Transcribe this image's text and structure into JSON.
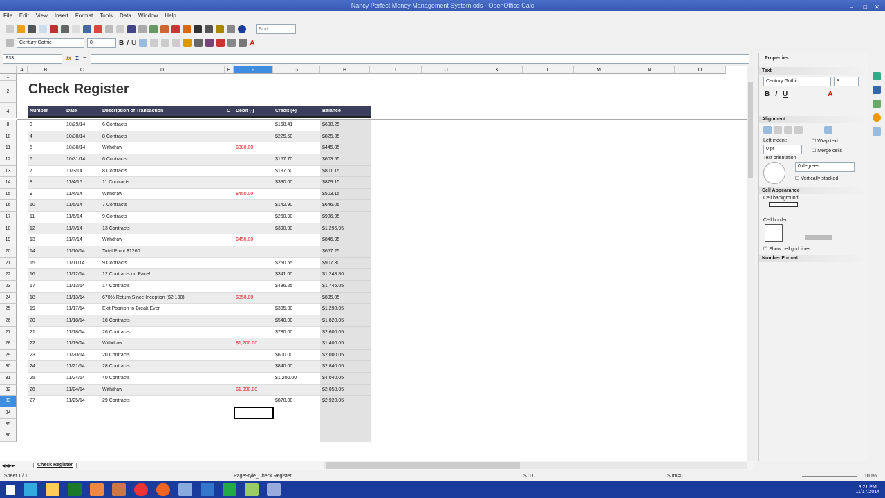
{
  "window": {
    "title": "Nancy Perfect Money Management System.ods - OpenOffice Calc"
  },
  "menu": [
    "File",
    "Edit",
    "View",
    "Insert",
    "Format",
    "Tools",
    "Data",
    "Window",
    "Help"
  ],
  "toolbar": {
    "find_placeholder": "Find",
    "font_name": "Century Gothic",
    "font_size": "8"
  },
  "formula_bar": {
    "cell_ref": "F33",
    "value": ""
  },
  "columns": [
    "A",
    "B",
    "C",
    "D",
    "E",
    "F",
    "G",
    "H",
    "I",
    "J",
    "K",
    "L",
    "M",
    "N",
    "O"
  ],
  "sheet": {
    "title": "Check Register",
    "headers": [
      "Number",
      "Date",
      "Description of Transaction",
      "C",
      "Debit (-)",
      "Credit (+)",
      "Balance"
    ],
    "rows": [
      {
        "row": "8",
        "num": "3",
        "date": "10/29/14",
        "desc": "6 Contracts",
        "debit": "",
        "credit": "$168.41",
        "balance": "$600.25"
      },
      {
        "row": "10",
        "num": "4",
        "date": "10/30/14",
        "desc": "8 Contracts",
        "debit": "",
        "credit": "$225.60",
        "balance": "$825.85"
      },
      {
        "row": "11",
        "num": "5",
        "date": "10/30/14",
        "desc": "Withdraw",
        "debit": "$380.00",
        "credit": "",
        "balance": "$445.85"
      },
      {
        "row": "12",
        "num": "6",
        "date": "10/31/14",
        "desc": "6 Contracts",
        "debit": "",
        "credit": "$157.70",
        "balance": "$603.55"
      },
      {
        "row": "13",
        "num": "7",
        "date": "11/3/14",
        "desc": "8 Contracts",
        "debit": "",
        "credit": "$197.60",
        "balance": "$801.15"
      },
      {
        "row": "14",
        "num": "8",
        "date": "11/4/15",
        "desc": "11 Contracts",
        "debit": "",
        "credit": "$330.00",
        "balance": "$879.15"
      },
      {
        "row": "15",
        "num": "9",
        "date": "11/4/14",
        "desc": "Withdraw",
        "debit": "$450.00",
        "credit": "",
        "balance": "$503.15"
      },
      {
        "row": "16",
        "num": "10",
        "date": "11/5/14",
        "desc": "7 Contracts",
        "debit": "",
        "credit": "$142.90",
        "balance": "$646.05"
      },
      {
        "row": "17",
        "num": "11",
        "date": "11/6/14",
        "desc": "9 Contracts",
        "debit": "",
        "credit": "$260.90",
        "balance": "$906.95"
      },
      {
        "row": "18",
        "num": "12",
        "date": "11/7/14",
        "desc": "13 Contracts",
        "debit": "",
        "credit": "$390.00",
        "balance": "$1,296.95"
      },
      {
        "row": "19",
        "num": "13",
        "date": "11/7/14",
        "desc": "Withdraw",
        "debit": "$450.00",
        "credit": "",
        "balance": "$846.95"
      },
      {
        "row": "20",
        "num": "14",
        "date": "11/10/14",
        "desc": "Total Profit  $1260",
        "debit": "",
        "credit": "",
        "balance": "$657.25"
      },
      {
        "row": "21",
        "num": "15",
        "date": "11/11/14",
        "desc": "9 Contracts",
        "debit": "",
        "credit": "$250.55",
        "balance": "$907.80"
      },
      {
        "row": "22",
        "num": "16",
        "date": "11/12/14",
        "desc": "12 Contracts on Pace!",
        "debit": "",
        "credit": "$341.00",
        "balance": "$1,248.80"
      },
      {
        "row": "23",
        "num": "17",
        "date": "11/13/14",
        "desc": "17 Contracts",
        "debit": "",
        "credit": "$496.25",
        "balance": "$1,745.05"
      },
      {
        "row": "24",
        "num": "18",
        "date": "11/13/14",
        "desc": "670% Return Since Inception ($2,130)",
        "debit": "$850.00",
        "credit": "",
        "balance": "$895.05"
      },
      {
        "row": "25",
        "num": "19",
        "date": "11/17/14",
        "desc": "Exit Position to Break Even",
        "debit": "",
        "credit": "$395.00",
        "balance": "$1,290.05"
      },
      {
        "row": "26",
        "num": "20",
        "date": "11/18/14",
        "desc": "18 Contracts",
        "debit": "",
        "credit": "$540.00",
        "balance": "$1,820.05"
      },
      {
        "row": "27",
        "num": "21",
        "date": "11/18/14",
        "desc": "26 Contracts",
        "debit": "",
        "credit": "$780.00",
        "balance": "$2,600.05"
      },
      {
        "row": "28",
        "num": "22",
        "date": "11/19/14",
        "desc": "Withdraw",
        "debit": "$1,200.00",
        "credit": "",
        "balance": "$1,400.05"
      },
      {
        "row": "29",
        "num": "23",
        "date": "11/20/14",
        "desc": "20 Contracts",
        "debit": "",
        "credit": "$600.00",
        "balance": "$2,000.05"
      },
      {
        "row": "30",
        "num": "24",
        "date": "11/21/14",
        "desc": "28 Contracts",
        "debit": "",
        "credit": "$840.00",
        "balance": "$2,840.05"
      },
      {
        "row": "31",
        "num": "25",
        "date": "11/24/14",
        "desc": "40 Contracts",
        "debit": "",
        "credit": "$1,200.00",
        "balance": "$4,040.05"
      },
      {
        "row": "32",
        "num": "26",
        "date": "11/24/14",
        "desc": "Withdraw",
        "debit": "$1,990.00",
        "credit": "",
        "balance": "$2,050.05"
      },
      {
        "row": "33",
        "num": "27",
        "date": "11/25/14",
        "desc": "29 Contracts",
        "debit": "",
        "credit": "$870.00",
        "balance": "$2,920.05"
      }
    ],
    "empty_rows": [
      "34",
      "35",
      "36"
    ]
  },
  "sheet_tab": "Check Register",
  "status": {
    "sheet": "Sheet 1 / 1",
    "page_style": "PageStyle_Check Register",
    "mode": "STD",
    "sum": "Sum=0",
    "zoom": "100%"
  },
  "sidebar": {
    "title": "Properties",
    "text_section": "Text",
    "font": "Century Gothic",
    "size": "8",
    "alignment_section": "Alignment",
    "left_indent_label": "Left indent:",
    "left_indent": "0 pt",
    "wrap_text": "Wrap text",
    "merge_cells": "Merge cells",
    "text_orientation_label": "Text orientation",
    "orientation": "0 degrees",
    "vertically_stacked": "Vertically stacked",
    "cell_appearance_section": "Cell Appearance",
    "cell_background_label": "Cell background:",
    "cell_border_label": "Cell border:",
    "show_grid": "Show cell grid lines",
    "number_format_section": "Number Format"
  },
  "taskbar": {
    "time": "3:21 PM",
    "date": "11/17/2014"
  },
  "colors": {
    "header_bg": "#3b3f5c",
    "debit": "#e0202a",
    "balance_bg": "#e2e2e2",
    "title_bar": "#3759b0",
    "taskbar": "#1a3a9c"
  }
}
